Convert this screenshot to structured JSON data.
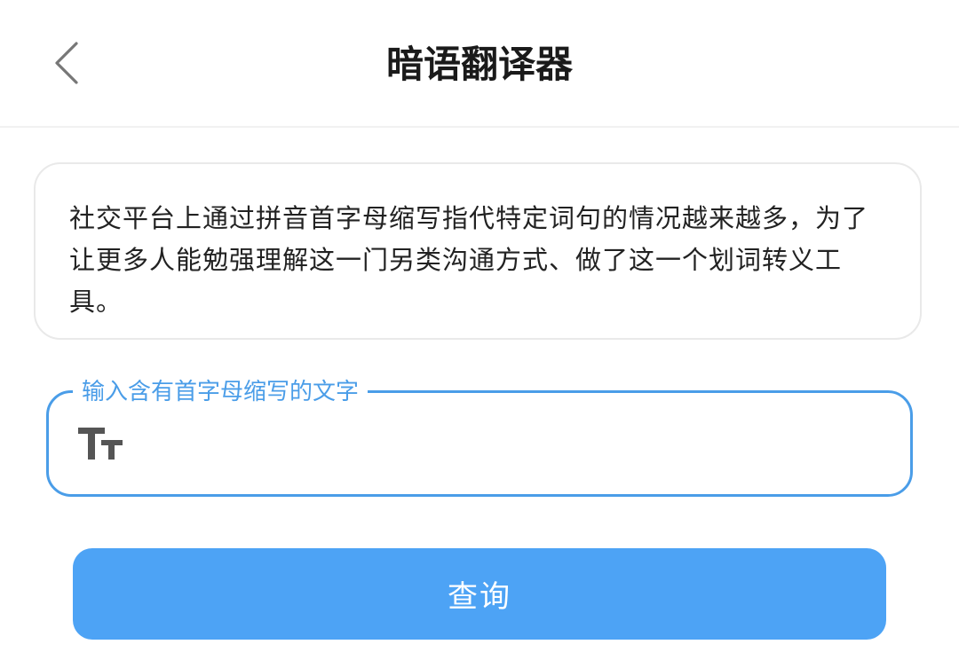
{
  "header": {
    "title": "暗语翻译器",
    "back_icon": "chevron-left-icon"
  },
  "intro": {
    "text": "社交平台上通过拼音首字母缩写指代特定词句的情况越来越多，为了让更多人能勉强理解这一门另类沟通方式、做了这一个划词转义工具。"
  },
  "input": {
    "label": "输入含有首字母缩写的文字",
    "value": "",
    "placeholder": "",
    "icon": "text-size-icon"
  },
  "query_button": {
    "label": "查询"
  },
  "colors": {
    "accent": "#4a9de8",
    "button": "#4da3f5",
    "title": "#1a1a1a",
    "card_border": "#e9e9e9",
    "icon_gray": "#555555"
  }
}
